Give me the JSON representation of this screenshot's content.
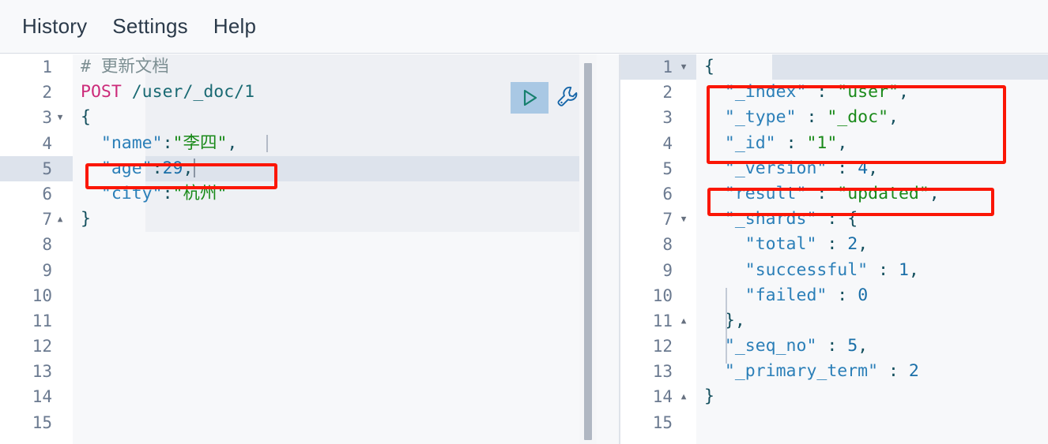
{
  "menu": {
    "items": [
      {
        "label": "History",
        "name": "menu-history"
      },
      {
        "label": "Settings",
        "name": "menu-settings"
      },
      {
        "label": "Help",
        "name": "menu-help"
      }
    ]
  },
  "toolbar": {
    "run_icon": "play-triangle-icon",
    "run_title": "Click to send request",
    "wrench_icon": "wrench-icon",
    "wrench_title": "Open documentation"
  },
  "request_editor": {
    "name": "request-editor",
    "total_lines": 15,
    "active_line": 5,
    "fold_down_lines": [
      3
    ],
    "fold_up_lines": [
      7
    ],
    "scope_lines": [
      1,
      2,
      3,
      4,
      5,
      6,
      7
    ],
    "line_numbers": [
      "1",
      "2",
      "3",
      "4",
      "5",
      "6",
      "7",
      "8",
      "9",
      "10",
      "11",
      "12",
      "13",
      "14",
      "15"
    ],
    "lines": [
      {
        "n": 1,
        "text": "# 更新文档"
      },
      {
        "n": 2,
        "text": "POST /user/_doc/1"
      },
      {
        "n": 3,
        "text": "{"
      },
      {
        "n": 4,
        "text": "  \"name\":\"李四\","
      },
      {
        "n": 5,
        "text": "  \"age\":29,"
      },
      {
        "n": 6,
        "text": "  \"city\":\"杭州\""
      },
      {
        "n": 7,
        "text": "}"
      },
      {
        "n": 8,
        "text": ""
      },
      {
        "n": 9,
        "text": ""
      },
      {
        "n": 10,
        "text": ""
      },
      {
        "n": 11,
        "text": ""
      },
      {
        "n": 12,
        "text": ""
      },
      {
        "n": 13,
        "text": ""
      },
      {
        "n": 14,
        "text": ""
      },
      {
        "n": 15,
        "text": ""
      }
    ],
    "tokens": {
      "comment_hash": "#",
      "comment_text": "更新文档",
      "method": "POST",
      "url": "/user/_doc/1",
      "open_brace": "{",
      "close_brace": "}",
      "name_key": "\"name\"",
      "name_sep": ":",
      "name_value": "\"李四\"",
      "name_comma": ",",
      "age_key": "\"age\"",
      "age_sep": ":",
      "age_value": "29",
      "age_comma": ",",
      "city_key": "\"city\"",
      "city_sep": ":",
      "city_value": "\"杭州\""
    }
  },
  "response_editor": {
    "name": "response-editor",
    "total_lines": 15,
    "active_line": 1,
    "fold_down_lines": [
      1,
      7
    ],
    "fold_up_lines": [
      11,
      14
    ],
    "line_numbers": [
      "1",
      "2",
      "3",
      "4",
      "5",
      "6",
      "7",
      "8",
      "9",
      "10",
      "11",
      "12",
      "13",
      "14",
      "15"
    ],
    "lines": [
      {
        "n": 1,
        "text": "{"
      },
      {
        "n": 2,
        "text": "  \"_index\" : \"user\","
      },
      {
        "n": 3,
        "text": "  \"_type\" : \"_doc\","
      },
      {
        "n": 4,
        "text": "  \"_id\" : \"1\","
      },
      {
        "n": 5,
        "text": "  \"_version\" : 4,"
      },
      {
        "n": 6,
        "text": "  \"result\" : \"updated\","
      },
      {
        "n": 7,
        "text": "  \"_shards\" : {"
      },
      {
        "n": 8,
        "text": "    \"total\" : 2,"
      },
      {
        "n": 9,
        "text": "    \"successful\" : 1,"
      },
      {
        "n": 10,
        "text": "    \"failed\" : 0"
      },
      {
        "n": 11,
        "text": "  },"
      },
      {
        "n": 12,
        "text": "  \"_seq_no\" : 5,"
      },
      {
        "n": 13,
        "text": "  \"_primary_term\" : 2"
      },
      {
        "n": 14,
        "text": "}"
      },
      {
        "n": 15,
        "text": ""
      }
    ],
    "tokens": {
      "open_brace": "{",
      "close_brace": "}",
      "colon": " : ",
      "comma": ",",
      "index_key": "\"_index\"",
      "index_value": "\"user\"",
      "type_key": "\"_type\"",
      "type_value": "\"_doc\"",
      "id_key": "\"_id\"",
      "id_value": "\"1\"",
      "version_key": "\"_version\"",
      "version_value": "4",
      "result_key": "\"result\"",
      "result_value": "\"updated\"",
      "shards_key": "\"_shards\"",
      "shards_open": "{",
      "total_key": "\"total\"",
      "total_value": "2",
      "successful_key": "\"successful\"",
      "successful_value": "1",
      "failed_key": "\"failed\"",
      "failed_value": "0",
      "shards_close": "},",
      "seq_no_key": "\"_seq_no\"",
      "seq_no_value": "5",
      "primary_term_key": "\"_primary_term\"",
      "primary_term_value": "2"
    }
  },
  "annotations": [
    {
      "name": "annotation-age-field",
      "target": "\"age\":29,"
    },
    {
      "name": "annotation-index-type-id",
      "target": "_index / _type / _id"
    },
    {
      "name": "annotation-result-updated",
      "target": "\"result\" : \"updated\","
    }
  ],
  "colors": {
    "annotation": "#fb1605",
    "method": "#cc2b7a",
    "key": "#2b7fb8",
    "string": "#1a8a1a",
    "comment": "#7d8f93",
    "run_button_bg": "#a9c8e4",
    "active_line": "#dde3ec"
  }
}
